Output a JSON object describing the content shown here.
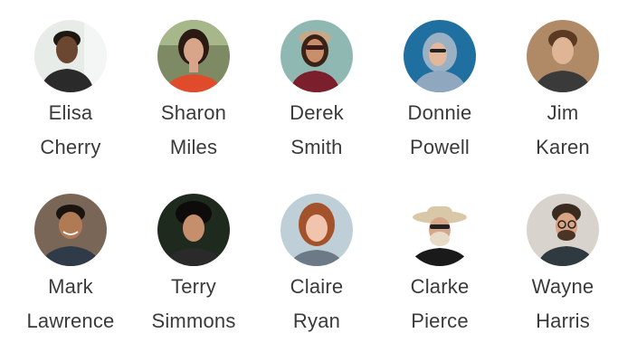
{
  "people": [
    {
      "first": "Elisa",
      "last": "Cherry",
      "bg": "#e8ece9",
      "skin": "#6b4630",
      "hair": "#1f1712",
      "shirt": "#2a2a2a"
    },
    {
      "first": "Sharon",
      "last": "Miles",
      "bg": "#7d8a63",
      "skin": "#d8a58a",
      "hair": "#2b1a14",
      "shirt": "#e04b2b"
    },
    {
      "first": "Derek",
      "last": "Smith",
      "bg": "#8fb8b2",
      "skin": "#c98f6b",
      "hair": "#3a2217",
      "shirt": "#7a1f2b"
    },
    {
      "first": "Donnie",
      "last": "Powell",
      "bg": "#1f6fa0",
      "skin": "#e2b79b",
      "hair": "#9ab0c4",
      "shirt": "#8fa8c0"
    },
    {
      "first": "Jim",
      "last": "Karen",
      "bg": "#b08a66",
      "skin": "#e0b596",
      "hair": "#5a3a22",
      "shirt": "#3a3a3a"
    },
    {
      "first": "Mark",
      "last": "Lawrence",
      "bg": "#7a6656",
      "skin": "#b07a55",
      "hair": "#1a1410",
      "shirt": "#2f3b48"
    },
    {
      "first": "Terry",
      "last": "Simmons",
      "bg": "#1e2a1e",
      "skin": "#c58e6c",
      "hair": "#0e0c0b",
      "shirt": "#2a2a2a"
    },
    {
      "first": "Claire",
      "last": "Ryan",
      "bg": "#bfcfd8",
      "skin": "#f0c4ad",
      "hair": "#a4522b",
      "shirt": "#6b7a86"
    },
    {
      "first": "Clarke",
      "last": "Pierce",
      "bg": "#ffffff",
      "skin": "#d6a68a",
      "hair": "#e8dcc8",
      "shirt": "#1a1a1a"
    },
    {
      "first": "Wayne",
      "last": "Harris",
      "bg": "#d8d3cc",
      "skin": "#d9a384",
      "hair": "#3a2a20",
      "shirt": "#2e3a40"
    }
  ]
}
